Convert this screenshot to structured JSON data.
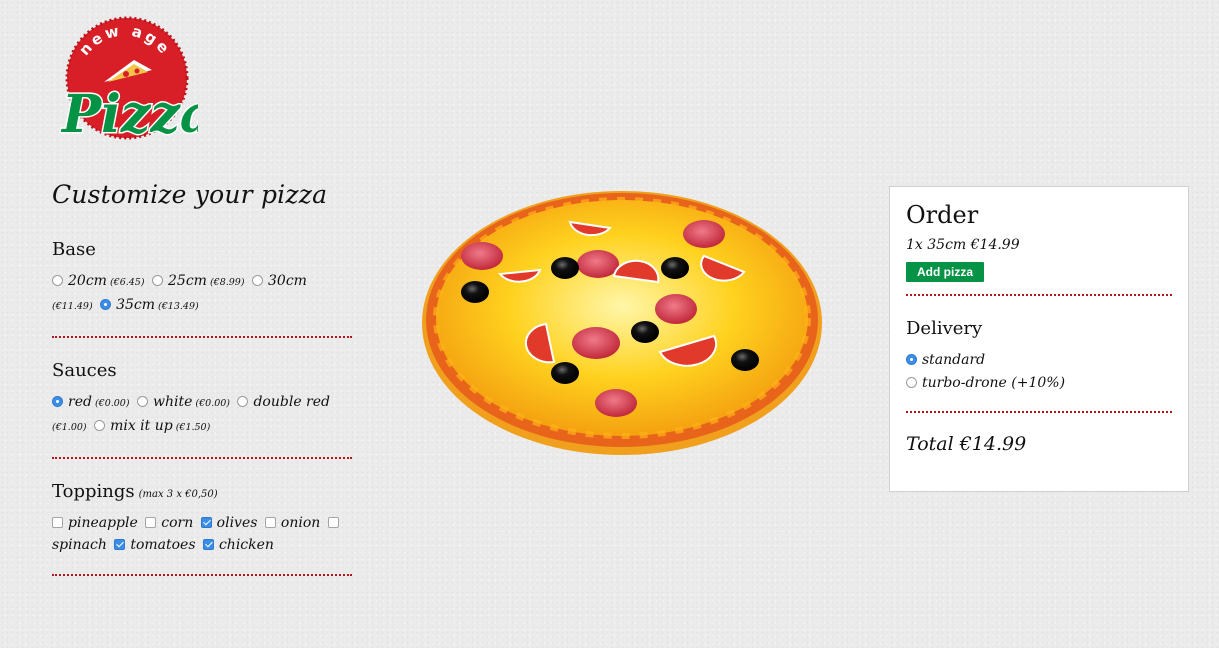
{
  "brand": {
    "arc_text": "new age",
    "word": "Pizza",
    "red": "#d81e26",
    "green": "#079345"
  },
  "customize": {
    "title": "Customize your pizza",
    "base": {
      "title": "Base",
      "options": [
        {
          "label": "20cm",
          "price": "(€6.45)",
          "selected": false
        },
        {
          "label": "25cm",
          "price": "(€8.99)",
          "selected": false
        },
        {
          "label": "30cm",
          "price": "(€11.49)",
          "selected": false
        },
        {
          "label": "35cm",
          "price": "(€13.49)",
          "selected": true
        }
      ]
    },
    "sauces": {
      "title": "Sauces",
      "options": [
        {
          "label": "red",
          "price": "(€0.00)",
          "selected": true
        },
        {
          "label": "white",
          "price": "(€0.00)",
          "selected": false
        },
        {
          "label": "double red",
          "price": "(€1.00)",
          "selected": false
        },
        {
          "label": "mix it up",
          "price": "(€1.50)",
          "selected": false
        }
      ]
    },
    "toppings": {
      "title": "Toppings",
      "note": "(max 3 x €0,50)",
      "options": [
        {
          "label": "pineapple",
          "checked": false
        },
        {
          "label": "corn",
          "checked": false
        },
        {
          "label": "olives",
          "checked": true
        },
        {
          "label": "onion",
          "checked": false
        },
        {
          "label": "spinach",
          "checked": false
        },
        {
          "label": "tomatoes",
          "checked": true
        },
        {
          "label": "chicken",
          "checked": true
        }
      ]
    }
  },
  "order": {
    "title": "Order",
    "line": "1x 35cm €14.99",
    "add_button": "Add pizza",
    "delivery": {
      "title": "Delivery",
      "options": [
        {
          "label": "standard",
          "selected": true
        },
        {
          "label": "turbo-drone (+10%)",
          "selected": false
        }
      ]
    },
    "total": "Total €14.99"
  }
}
